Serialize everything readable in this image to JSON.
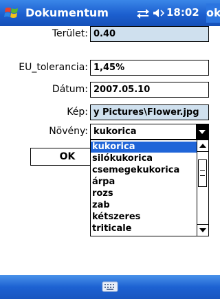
{
  "titlebar": {
    "app_title": "Dokumentum",
    "clock": "18:02",
    "ok_label": "ok"
  },
  "form": {
    "terulet": {
      "label": "Terület:",
      "value": "0.40"
    },
    "eu_tolerancia": {
      "label": "EU_tolerancia:",
      "value": "1,45%"
    },
    "datum": {
      "label": "Dátum:",
      "value": "2007.05.10"
    },
    "kep": {
      "label": "Kép:",
      "value": "y Pictures\\Flower.jpg"
    },
    "noveny": {
      "label": "Növény:",
      "value": "kukorica"
    },
    "ok_button": "OK"
  },
  "dropdown": {
    "items": [
      "kukorica",
      "silókukorica",
      "csemegekukorica",
      "árpa",
      "rozs",
      "zab",
      "kétszeres",
      "triticale"
    ],
    "selected_index": 0
  },
  "icons": {
    "start": "windows-start-icon",
    "connectivity": "connectivity-icon",
    "volume": "volume-icon",
    "keyboard": "keyboard-icon"
  },
  "colors": {
    "titlebar": "#1c5fcf",
    "readonly_field": "#cfe0ee",
    "selection": "#2065d8"
  }
}
